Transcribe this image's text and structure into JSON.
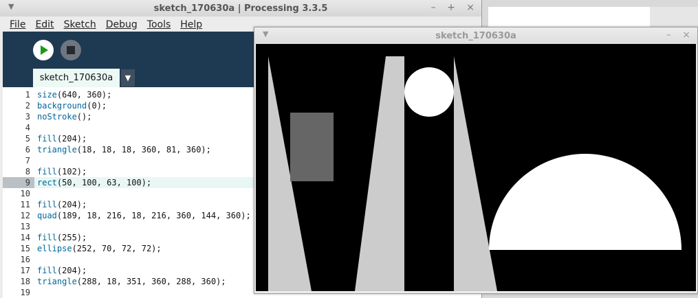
{
  "ide": {
    "title": "sketch_170630a | Processing 3.3.5",
    "window_controls": {
      "minimize": "–",
      "maximize": "+",
      "close": "×"
    },
    "menu": [
      {
        "label": "File"
      },
      {
        "label": "Edit"
      },
      {
        "label": "Sketch"
      },
      {
        "label": "Debug"
      },
      {
        "label": "Tools"
      },
      {
        "label": "Help"
      }
    ],
    "tab": {
      "label": "sketch_170630a",
      "menu_glyph": "▼"
    },
    "code_lines": [
      {
        "n": "1",
        "fn": "size",
        "rest": "(640, 360);"
      },
      {
        "n": "2",
        "fn": "background",
        "rest": "(0);"
      },
      {
        "n": "3",
        "fn": "noStroke",
        "rest": "();"
      },
      {
        "n": "4",
        "fn": "",
        "rest": ""
      },
      {
        "n": "5",
        "fn": "fill",
        "rest": "(204);"
      },
      {
        "n": "6",
        "fn": "triangle",
        "rest": "(18, 18, 18, 360, 81, 360);"
      },
      {
        "n": "7",
        "fn": "",
        "rest": ""
      },
      {
        "n": "8",
        "fn": "fill",
        "rest": "(102);"
      },
      {
        "n": "9",
        "fn": "rect",
        "rest": "(50, 100, 63, 100);"
      },
      {
        "n": "10",
        "fn": "",
        "rest": ""
      },
      {
        "n": "11",
        "fn": "fill",
        "rest": "(204);"
      },
      {
        "n": "12",
        "fn": "quad",
        "rest": "(189, 18, 216, 18, 216, 360, 144, 360);"
      },
      {
        "n": "13",
        "fn": "",
        "rest": ""
      },
      {
        "n": "14",
        "fn": "fill",
        "rest": "(255);"
      },
      {
        "n": "15",
        "fn": "ellipse",
        "rest": "(252, 70, 72, 72);"
      },
      {
        "n": "16",
        "fn": "",
        "rest": ""
      },
      {
        "n": "17",
        "fn": "fill",
        "rest": "(204);"
      },
      {
        "n": "18",
        "fn": "triangle",
        "rest": "(288, 18, 351, 360, 288, 360);"
      },
      {
        "n": "19",
        "fn": "",
        "rest": ""
      }
    ],
    "highlighted_line": "9"
  },
  "sketch_window": {
    "title": "sketch_170630a",
    "window_controls": {
      "minimize": "–",
      "close": "×"
    }
  },
  "colors": {
    "editor_bg": "#1e3a52",
    "run_green": "#1a9a1a",
    "function_blue": "#006699",
    "canvas_bg": "#000000"
  }
}
